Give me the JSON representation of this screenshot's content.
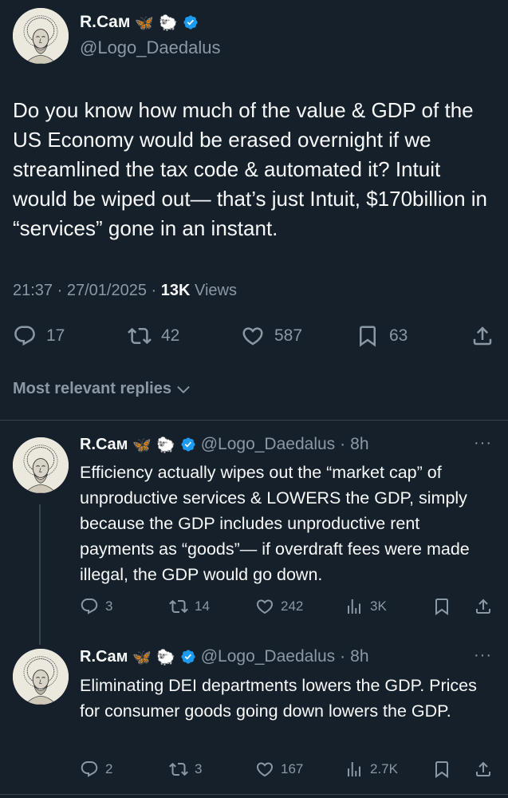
{
  "post": {
    "author": {
      "name": "R.Caм",
      "handle": "@Logo_Daedalus",
      "emoji_butterfly": "🦋",
      "emoji_sheep": "🐑"
    },
    "text": "Do you know how much of the value & GDP of the US Economy would be erased overnight if we streamlined the tax code & automated it? Intuit would be wiped out— that’s just Intuit, $170billion in “services” gone in an instant.",
    "time": "21:37",
    "date": "27/01/2025",
    "views_count": "13K",
    "views_label": "Views",
    "stats": {
      "replies": "17",
      "reposts": "42",
      "likes": "587",
      "bookmarks": "63"
    }
  },
  "replies_filter": "Most relevant replies",
  "replies": [
    {
      "name": "R.Caм",
      "emoji_butterfly": "🦋",
      "emoji_sheep": "🐑",
      "handle": "@Logo_Daedalus",
      "time": "8h",
      "text": "Efficiency actually wipes out the “market cap” of unproductive services & LOWERS the GDP, simply because the GDP includes unproductive rent payments as “goods”— if overdraft fees were made illegal, the GDP would go down.",
      "replies": "3",
      "reposts": "14",
      "likes": "242",
      "views": "3K"
    },
    {
      "name": "R.Caм",
      "emoji_butterfly": "🦋",
      "emoji_sheep": "🐑",
      "handle": "@Logo_Daedalus",
      "time": "8h",
      "text": "Eliminating DEI departments lowers the GDP. Prices for consumer goods going down lowers the GDP.",
      "replies": "2",
      "reposts": "3",
      "likes": "167",
      "views": "2.7K"
    }
  ],
  "colors": {
    "background": "#15202b",
    "text": "#f7f9f9",
    "secondary": "#8b98a5",
    "accent": "#1d9bf0",
    "divider": "#38444d"
  }
}
